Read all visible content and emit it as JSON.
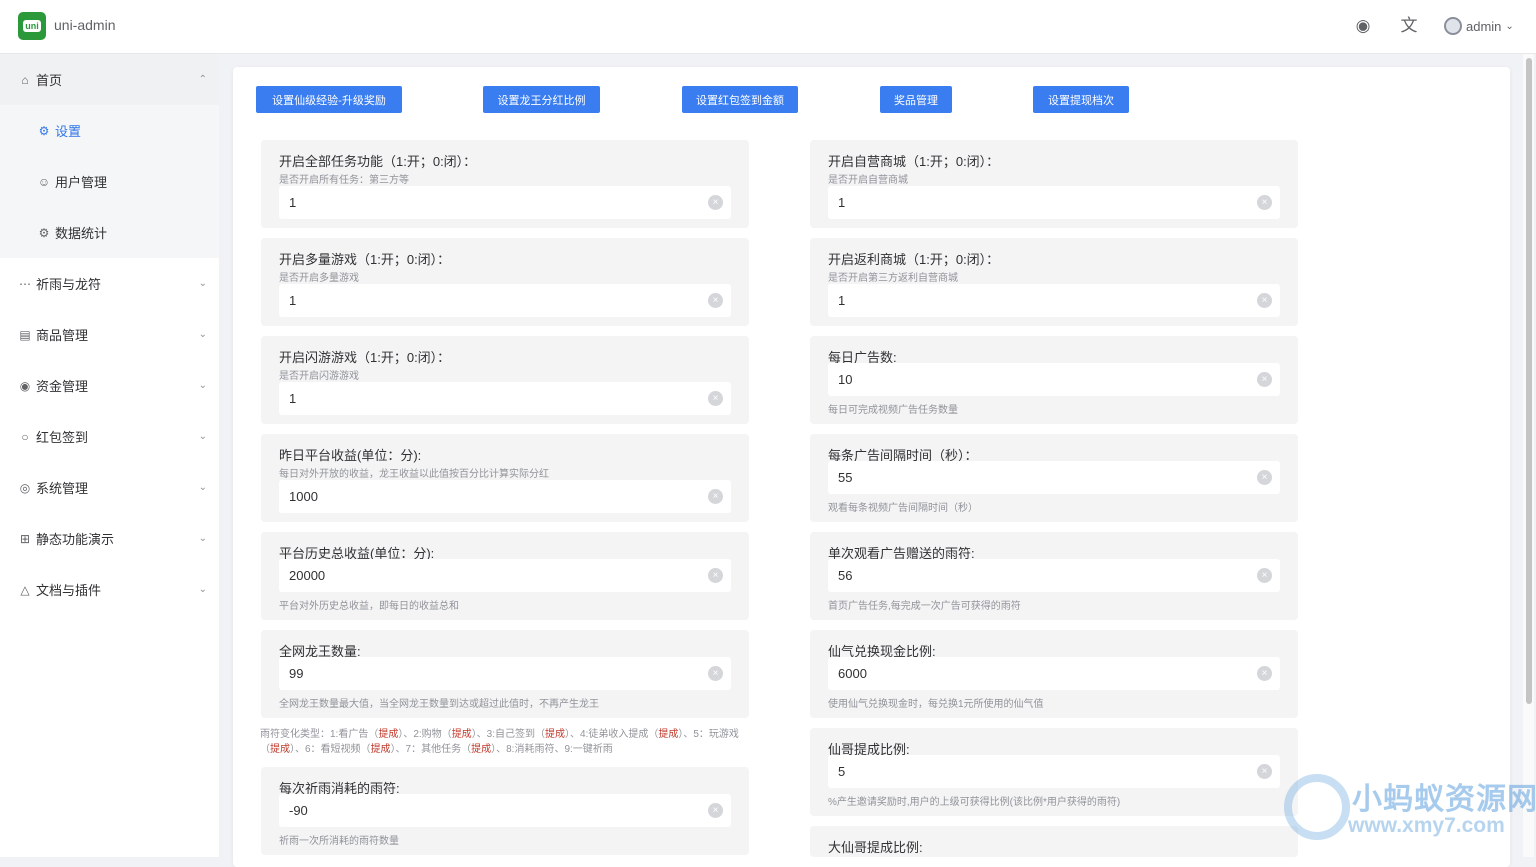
{
  "header": {
    "logo_text": "uni",
    "app_title": "uni-admin",
    "theme_icon": "palette-icon",
    "lang_icon": "translate-icon",
    "user_name": "admin"
  },
  "sidebar": {
    "items": [
      {
        "label": "首页",
        "icon": "home-icon"
      },
      {
        "label": "设置",
        "icon": "gear-icon"
      },
      {
        "label": "用户管理",
        "icon": "user-icon"
      },
      {
        "label": "数据统计",
        "icon": "gear-icon"
      },
      {
        "label": "祈雨与龙符",
        "icon": "more-icon"
      },
      {
        "label": "商品管理",
        "icon": "box-icon"
      },
      {
        "label": "资金管理",
        "icon": "eye-icon"
      },
      {
        "label": "红包签到",
        "icon": "circle-icon"
      },
      {
        "label": "系统管理",
        "icon": "settings-icon"
      },
      {
        "label": "静态功能演示",
        "icon": "grid-icon"
      },
      {
        "label": "文档与插件",
        "icon": "docs-icon"
      }
    ]
  },
  "toolbar": {
    "buttons": [
      "设置仙级经验-升级奖励",
      "设置龙王分红比例",
      "设置红包签到金额",
      "奖品管理",
      "设置提现档次"
    ]
  },
  "left_fields": [
    {
      "label": "开启全部任务功能（1:开；0:闭）：",
      "hint": "是否开启所有任务：第三方等",
      "value": "1"
    },
    {
      "label": "开启多量游戏（1:开；0:闭）：",
      "hint": "是否开启多量游戏",
      "value": "1"
    },
    {
      "label": "开启闪游游戏（1:开；0:闭）：",
      "hint": "是否开启闪游游戏",
      "value": "1"
    },
    {
      "label": "昨日平台收益(单位：分):",
      "hint": "每日对外开放的收益，龙王收益以此值按百分比计算实际分红",
      "value": "1000"
    },
    {
      "label": "平台历史总收益(单位：分):",
      "hint": "平台对外历史总收益，即每日的收益总和",
      "value": "20000"
    },
    {
      "label": "全网龙王数量:",
      "hint": "全网龙王数量最大值，当全网龙王数量到达或超过此值时，不再产生龙王",
      "value": "99"
    },
    {
      "label": "每次祈雨消耗的雨符:",
      "hint": "祈雨一次所消耗的雨符数量",
      "value": "-90"
    }
  ],
  "right_fields": [
    {
      "label": "开启自营商城（1:开；0:闭）：",
      "hint": "是否开启自营商城",
      "value": "1"
    },
    {
      "label": "开启返利商城（1:开；0:闭）：",
      "hint": "是否开启第三方返利自营商城",
      "value": "1"
    },
    {
      "label": "每日广告数:",
      "hint": "每日可完成视频广告任务数量",
      "value": "10"
    },
    {
      "label": "每条广告间隔时间（秒）：",
      "hint": "观看每条视频广告间隔时间（秒）",
      "value": "55"
    },
    {
      "label": "单次观看广告赠送的雨符:",
      "hint": "首页广告任务,每完成一次广告可获得的雨符",
      "value": "56"
    },
    {
      "label": "仙气兑换现金比例:",
      "hint": "使用仙气兑换现金时，每兑换1元所使用的仙气值",
      "value": "6000"
    },
    {
      "label": "仙哥提成比例:",
      "hint": "%产生邀请奖励时,用户的上级可获得比例(该比例*用户获得的雨符)",
      "value": "5"
    },
    {
      "label": "大仙哥提成比例:",
      "hint": "",
      "value": ""
    }
  ],
  "rain_note": {
    "parts": [
      "雨符变化类型：1:看广告（",
      "提成",
      "）、2:购物（",
      "提成",
      "）、3:自己签到（",
      "提成",
      "）、4:徒弟收入提成（",
      "提成",
      "）、5：玩游戏（",
      "提成",
      "）、6：看短视频（",
      "提成",
      "）、7：其他任务（",
      "提成",
      "）、8:消耗雨符、9:一键祈雨"
    ]
  },
  "watermark": {
    "title": "小蚂蚁资源网",
    "url": "www.xmy7.com"
  }
}
